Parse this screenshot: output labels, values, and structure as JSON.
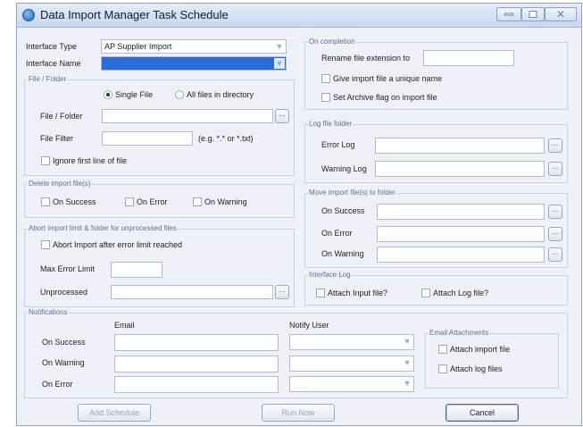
{
  "window": {
    "title": "Data Import Manager Task Schedule"
  },
  "interface": {
    "type_label": "Interface Type",
    "type_value": "AP Supplier Import",
    "name_label": "Interface Name",
    "name_value": ""
  },
  "file_folder": {
    "group_title": "File / Folder",
    "radio_single": "Single File",
    "radio_all": "All files in directory",
    "file_folder_label": "File / Folder",
    "file_filter_label": "File Filter",
    "file_filter_hint": "(e.g. *.* or *.txt)",
    "ignore_first_line": "Ignore first line of file"
  },
  "delete_import": {
    "group_title": "Delete import file(s)",
    "on_success": "On Success",
    "on_error": "On Error",
    "on_warning": "On Warning"
  },
  "abort": {
    "group_title": "Abort import limit & folder for unprocessed files",
    "abort_check": "Abort Import after error limit reached",
    "max_error_label": "Max Error Limit",
    "unprocessed_label": "Unprocessed"
  },
  "on_completion": {
    "group_title": "On completion",
    "rename_label": "Rename file extension to",
    "unique_name": "Give import file a unique name",
    "archive_flag": "Set Archive flag on import file"
  },
  "log_folder": {
    "group_title": "Log file folder",
    "error_log": "Error Log",
    "warning_log": "Warning Log"
  },
  "move_import": {
    "group_title": "Move import file(s) to folder",
    "on_success": "On Success",
    "on_error": "On Error",
    "on_warning": "On Warning"
  },
  "interface_log": {
    "group_title": "Interface Log",
    "attach_input": "Attach Input file?",
    "attach_log": "Attach Log file?"
  },
  "notifications": {
    "group_title": "Notifications",
    "email_header": "Email",
    "notify_user_header": "Notify User",
    "rows": [
      "On Success",
      "On Warning",
      "On Error"
    ],
    "attachments_title": "Email Attachments",
    "attach_import": "Attach import file",
    "attach_log": "Attach log files"
  },
  "buttons": {
    "add_schedule": "Add Schedule",
    "run_now": "Run Now",
    "cancel": "Cancel"
  },
  "browse_glyph": "..."
}
